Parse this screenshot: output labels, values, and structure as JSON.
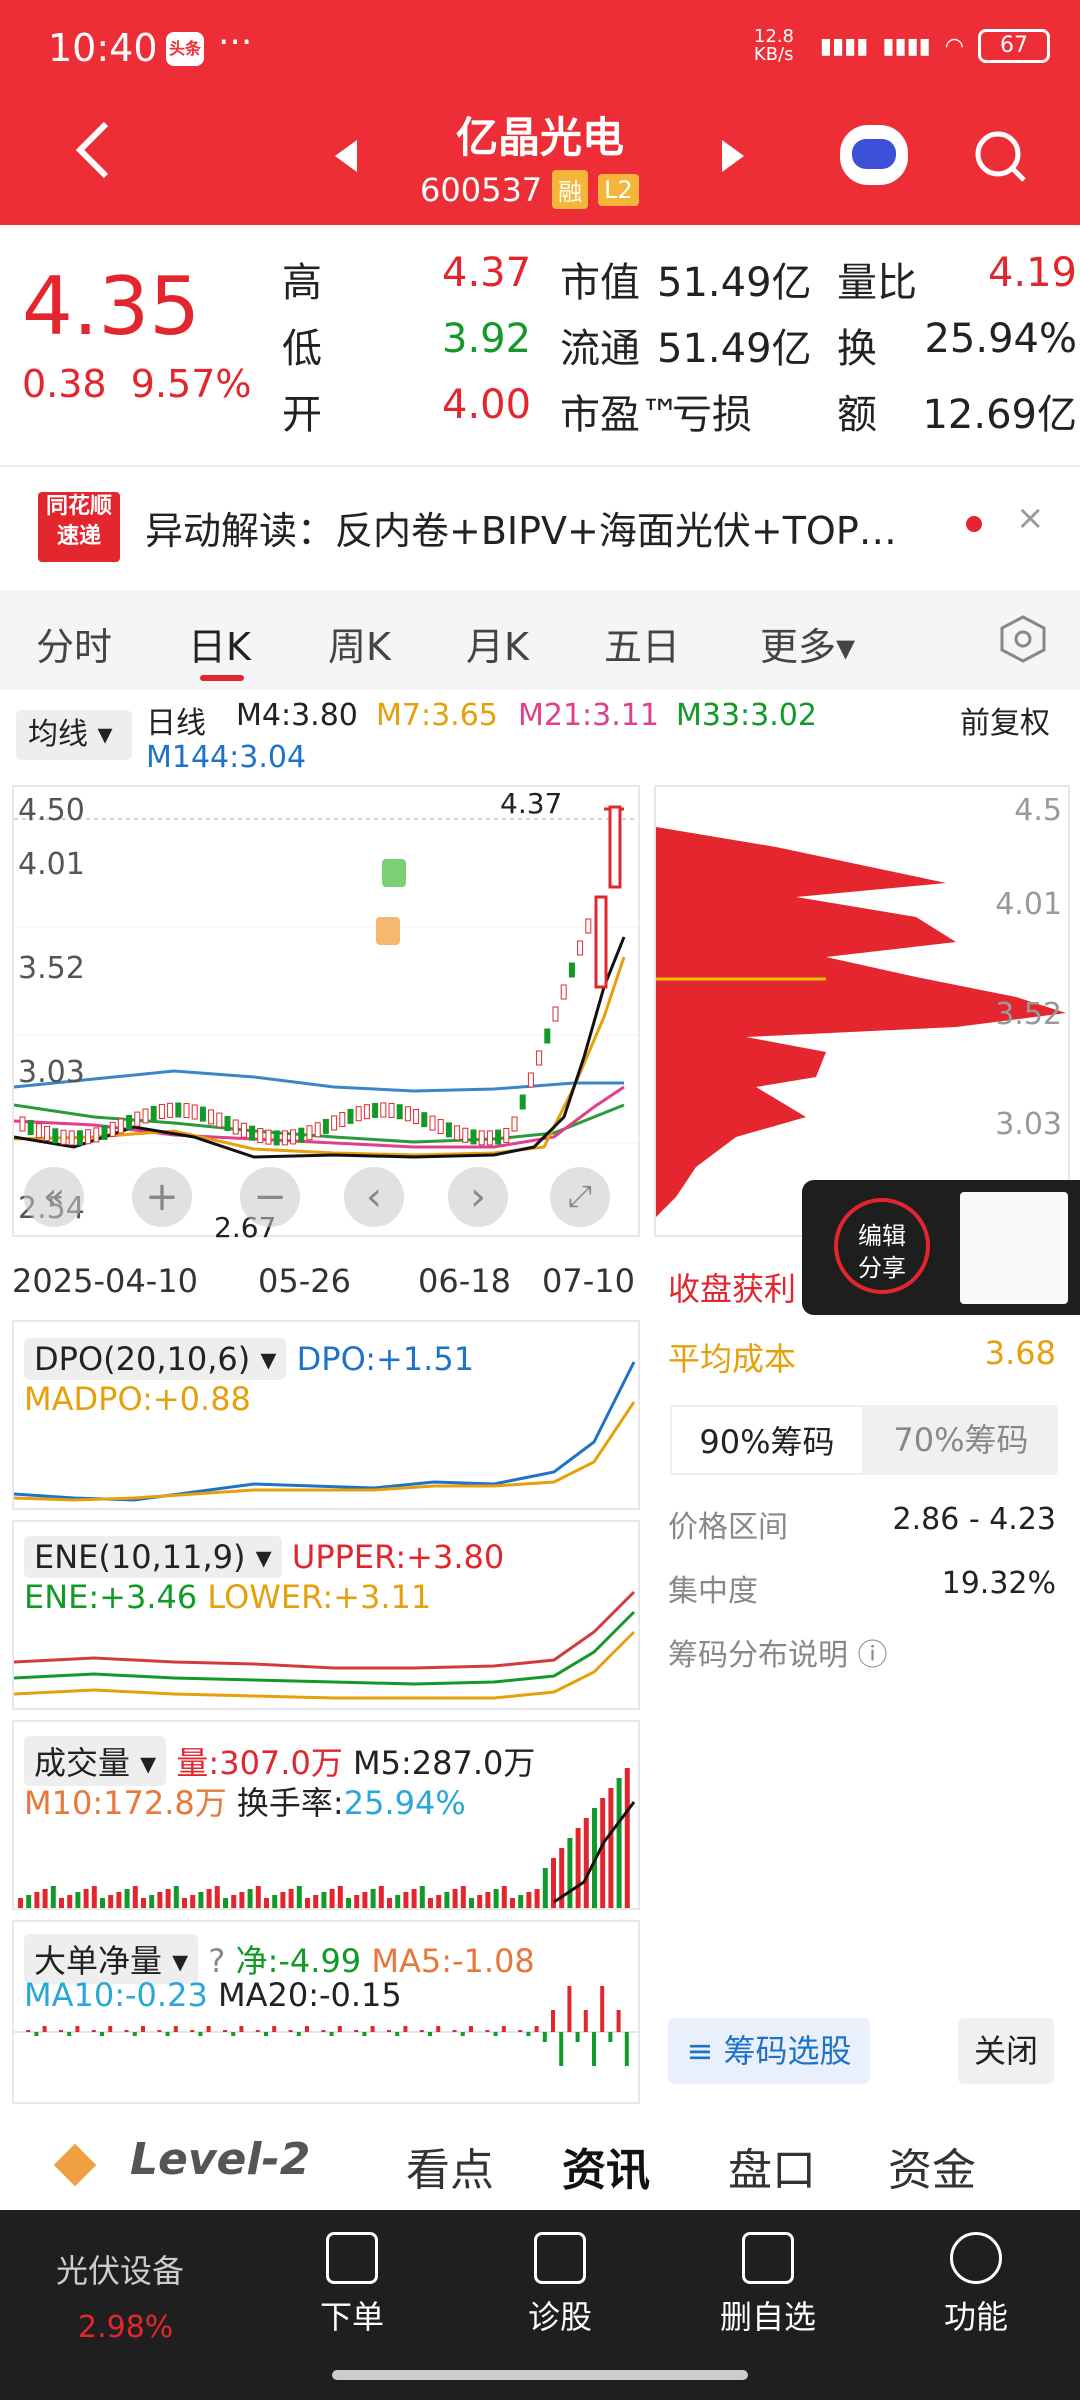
{
  "status": {
    "time": "10:40",
    "app_badge": "头条",
    "dots": "···",
    "net": "12.8 KB/s",
    "battery": "67"
  },
  "header": {
    "title": "亿晶光电",
    "code": "600537",
    "tag_rong": "融",
    "tag_l2": "L2"
  },
  "quote": {
    "price": "4.35",
    "change": "0.38",
    "change_pct": "9.57%",
    "rows": [
      {
        "k1": "高",
        "v1": "4.37",
        "k2": "市值",
        "v2": "51.49亿",
        "k3": "量比",
        "v3": "4.19"
      },
      {
        "k1": "低",
        "v1": "3.92",
        "k2": "流通",
        "v2": "51.49亿",
        "k3": "换",
        "v3": "25.94%"
      },
      {
        "k1": "开",
        "v1": "4.00",
        "k2": "市盈™",
        "v2": "亏损",
        "k3": "额",
        "v3": "12.69亿"
      }
    ]
  },
  "news": {
    "logo_top": "同花顺",
    "logo_bottom": "速递",
    "text": "异动解读：反内卷+BIPV+海面光伏+TOP…",
    "close": "×"
  },
  "tabs": [
    "分时",
    "日K",
    "周K",
    "月K",
    "五日",
    "更多▾"
  ],
  "ma": {
    "select": "均线 ▾",
    "label": "日线",
    "m4": "M4:3.80",
    "m7": "M7:3.65",
    "m21": "M21:3.11",
    "m33": "M33:3.02",
    "m144": "M144:3.04",
    "fq": "前复权"
  },
  "kchart": {
    "ylabels": [
      "4.50",
      "4.01",
      "3.52",
      "3.03",
      "2.54"
    ],
    "high_label": "4.37",
    "low_label": "2.67",
    "dates": [
      "2025-04-10",
      "05-26",
      "06-18",
      "07-10"
    ],
    "profile_labels": [
      "4.5",
      "4.01",
      "3.52",
      "3.03"
    ]
  },
  "chip": {
    "title": "收盘获利",
    "avg_cost_label": "平均成本",
    "avg_cost": "3.68",
    "tab90": "90%筹码",
    "tab70": "70%筹码",
    "range_label": "价格区间",
    "range": "2.86 - 4.23",
    "concentration_label": "集中度",
    "concentration": "19.32%",
    "explain": "筹码分布说明 ⓘ",
    "select_btn": "筹码选股",
    "close_btn": "关闭"
  },
  "float_btn": {
    "line1": "编辑",
    "line2": "分享"
  },
  "dpo": {
    "name": "DPO(20,10,6) ▾",
    "dpo": "DPO:+1.51",
    "madpo": "MADPO:+0.88"
  },
  "ene": {
    "name": "ENE(10,11,9) ▾",
    "upper": "UPPER:+3.80",
    "ene": "ENE:+3.46",
    "lower": "LOWER:+3.11"
  },
  "vol": {
    "name": "成交量 ▾",
    "vol": "量:307.0万",
    "m5": "M5:287.0万",
    "m10": "M10:172.8万",
    "hs_label": "换手率:",
    "hs": "25.94%"
  },
  "bigorder": {
    "name": "大单净量 ▾",
    "help": "?",
    "net": "净:-4.99",
    "ma5": "MA5:-1.08",
    "ma10": "MA10:-0.23",
    "ma20": "MA20:-0.15"
  },
  "bottom_tabs": [
    "Level-2",
    "看点",
    "资讯",
    "盘口",
    "资金"
  ],
  "bottom_bar": {
    "sector": "光伏设备",
    "sector_pct": "2.98%",
    "items": [
      "下单",
      "诊股",
      "删自选",
      "功能"
    ]
  }
}
